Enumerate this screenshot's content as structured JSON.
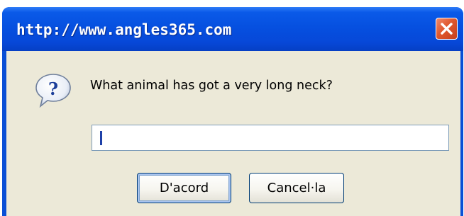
{
  "window": {
    "title": "http://www.angles365.com"
  },
  "dialog": {
    "prompt": "What animal has got a very long neck?",
    "input_value": "",
    "ok_label": "D'acord",
    "cancel_label": "Cancel·la",
    "icon": "question-icon"
  },
  "colors": {
    "titlebar": "#0650e0",
    "client_background": "#ece9d8",
    "close_button": "#e0582e",
    "input_border": "#7f9db9"
  }
}
